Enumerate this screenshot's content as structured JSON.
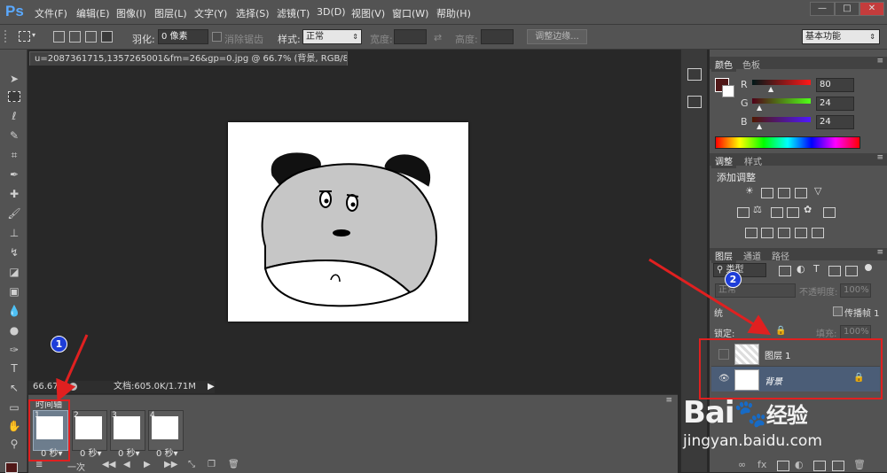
{
  "app": {
    "logo": "Ps"
  },
  "menu": [
    "文件(F)",
    "编辑(E)",
    "图像(I)",
    "图层(L)",
    "文字(Y)",
    "选择(S)",
    "滤镜(T)",
    "3D(D)",
    "视图(V)",
    "窗口(W)",
    "帮助(H)"
  ],
  "window_controls": [
    "—",
    "□",
    "✕"
  ],
  "options": {
    "feather_label": "羽化:",
    "feather_value": "0 像素",
    "antialias_label": "消除锯齿",
    "style_label": "样式:",
    "style_value": "正常",
    "width_label": "宽度:",
    "height_label": "高度:",
    "refine_edge_button": "调整边缘...",
    "workspace": "基本功能"
  },
  "document": {
    "tab_title": "u=2087361715,1357265001&fm=26&gp=0.jpg @ 66.7% (背景, RGB/8*) *",
    "zoom": "66.67%",
    "doc_size": "文档:605.0K/1.71M"
  },
  "timeline": {
    "title": "时间轴",
    "frames": [
      {
        "num": "1",
        "delay": "0 秒▾"
      },
      {
        "num": "2",
        "delay": "0 秒▾"
      },
      {
        "num": "3",
        "delay": "0 秒▾"
      },
      {
        "num": "4",
        "delay": "0 秒▾"
      }
    ],
    "loop_label": "一次"
  },
  "color_panel": {
    "tabs": [
      "颜色",
      "色板"
    ],
    "channels": [
      {
        "label": "R",
        "value": "80"
      },
      {
        "label": "G",
        "value": "24"
      },
      {
        "label": "B",
        "value": "24"
      }
    ],
    "foreground_color": "#501818"
  },
  "adjust_panel": {
    "tabs": [
      "调整",
      "样式"
    ],
    "title": "添加调整"
  },
  "layers_panel": {
    "tabs": [
      "图层",
      "通道",
      "路径"
    ],
    "filter_label": "类型",
    "blend_mode": "正常",
    "opacity_label": "不透明度:",
    "opacity_value": "100%",
    "unify_label": "统",
    "propagate_label": "传播帧 1",
    "lock_label": "锁定:",
    "fill_label": "填充:",
    "fill_value": "100%",
    "layers": [
      {
        "name": "图层 1",
        "visible": false
      },
      {
        "name": "背景",
        "visible": true,
        "locked": true
      }
    ]
  },
  "annotations": {
    "badge1": "1",
    "badge2": "2"
  },
  "watermark": {
    "brand": "Bai",
    "brand2": "经验",
    "url": "jingyan.baidu.com"
  },
  "colors": {
    "accent_red": "#e02020",
    "badge_blue": "#1d3dd8",
    "selected_layer": "#4b5d77"
  }
}
